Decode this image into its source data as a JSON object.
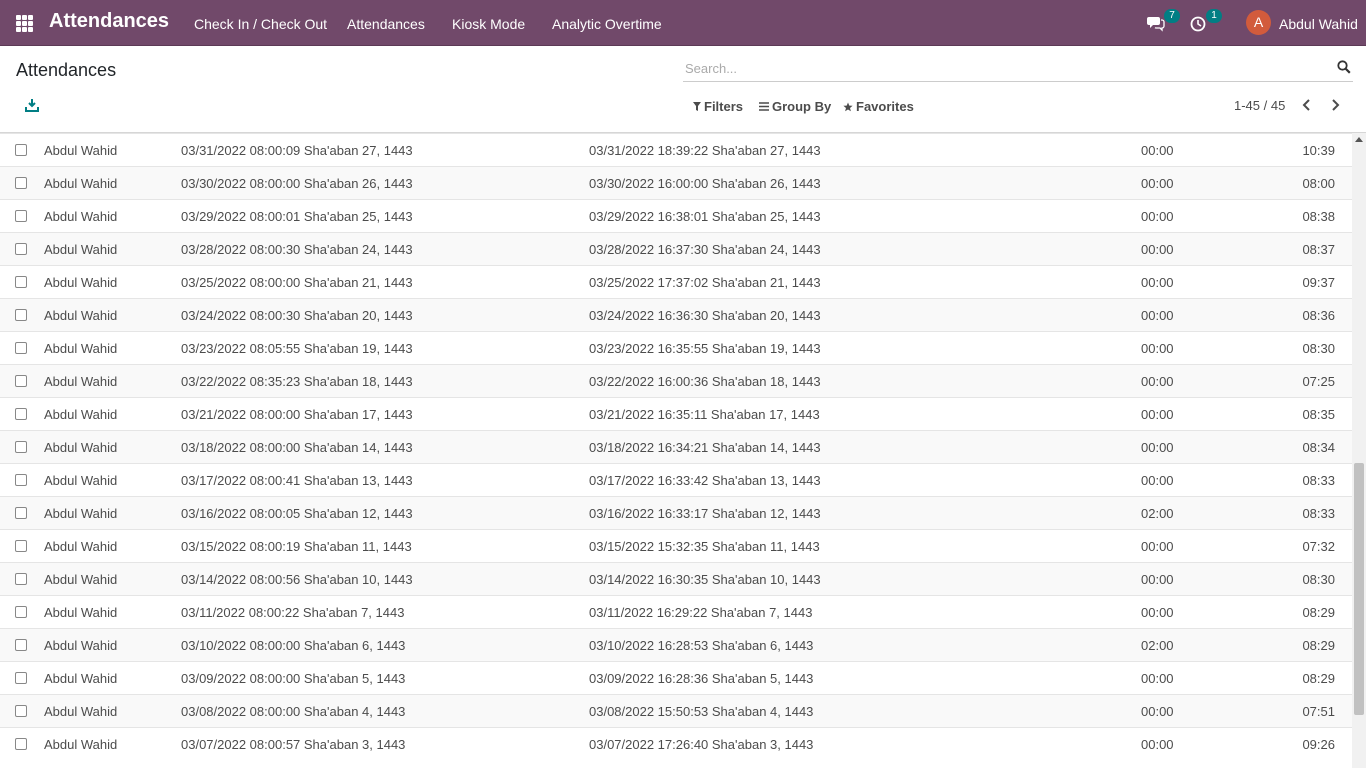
{
  "navbar": {
    "app_title": "Attendances",
    "menu": [
      "Check In / Check Out",
      "Attendances",
      "Kiosk Mode",
      "Analytic Overtime"
    ],
    "messages_count": "7",
    "activities_count": "1",
    "user_initial": "A",
    "user_name": "Abdul Wahid",
    "bg_color": "#71496a",
    "badge_color": "#017e84",
    "avatar_color": "#d25b3c"
  },
  "control_panel": {
    "title": "Attendances",
    "search_placeholder": "Search...",
    "filters_label": "Filters",
    "group_by_label": "Group By",
    "favorites_label": "Favorites",
    "pager_value": "1-45 / 45"
  },
  "rows": [
    {
      "employee": "Abdul Wahid",
      "check_in": "03/31/2022 08:00:09 Sha'aban 27, 1443",
      "check_out": "03/31/2022 18:39:22 Sha'aban 27, 1443",
      "overtime": "00:00",
      "worked": "10:39"
    },
    {
      "employee": "Abdul Wahid",
      "check_in": "03/30/2022 08:00:00 Sha'aban 26, 1443",
      "check_out": "03/30/2022 16:00:00 Sha'aban 26, 1443",
      "overtime": "00:00",
      "worked": "08:00"
    },
    {
      "employee": "Abdul Wahid",
      "check_in": "03/29/2022 08:00:01 Sha'aban 25, 1443",
      "check_out": "03/29/2022 16:38:01 Sha'aban 25, 1443",
      "overtime": "00:00",
      "worked": "08:38"
    },
    {
      "employee": "Abdul Wahid",
      "check_in": "03/28/2022 08:00:30 Sha'aban 24, 1443",
      "check_out": "03/28/2022 16:37:30 Sha'aban 24, 1443",
      "overtime": "00:00",
      "worked": "08:37"
    },
    {
      "employee": "Abdul Wahid",
      "check_in": "03/25/2022 08:00:00 Sha'aban 21, 1443",
      "check_out": "03/25/2022 17:37:02 Sha'aban 21, 1443",
      "overtime": "00:00",
      "worked": "09:37"
    },
    {
      "employee": "Abdul Wahid",
      "check_in": "03/24/2022 08:00:30 Sha'aban 20, 1443",
      "check_out": "03/24/2022 16:36:30 Sha'aban 20, 1443",
      "overtime": "00:00",
      "worked": "08:36"
    },
    {
      "employee": "Abdul Wahid",
      "check_in": "03/23/2022 08:05:55 Sha'aban 19, 1443",
      "check_out": "03/23/2022 16:35:55 Sha'aban 19, 1443",
      "overtime": "00:00",
      "worked": "08:30"
    },
    {
      "employee": "Abdul Wahid",
      "check_in": "03/22/2022 08:35:23 Sha'aban 18, 1443",
      "check_out": "03/22/2022 16:00:36 Sha'aban 18, 1443",
      "overtime": "00:00",
      "worked": "07:25"
    },
    {
      "employee": "Abdul Wahid",
      "check_in": "03/21/2022 08:00:00 Sha'aban 17, 1443",
      "check_out": "03/21/2022 16:35:11 Sha'aban 17, 1443",
      "overtime": "00:00",
      "worked": "08:35"
    },
    {
      "employee": "Abdul Wahid",
      "check_in": "03/18/2022 08:00:00 Sha'aban 14, 1443",
      "check_out": "03/18/2022 16:34:21 Sha'aban 14, 1443",
      "overtime": "00:00",
      "worked": "08:34"
    },
    {
      "employee": "Abdul Wahid",
      "check_in": "03/17/2022 08:00:41 Sha'aban 13, 1443",
      "check_out": "03/17/2022 16:33:42 Sha'aban 13, 1443",
      "overtime": "00:00",
      "worked": "08:33"
    },
    {
      "employee": "Abdul Wahid",
      "check_in": "03/16/2022 08:00:05 Sha'aban 12, 1443",
      "check_out": "03/16/2022 16:33:17 Sha'aban 12, 1443",
      "overtime": "02:00",
      "worked": "08:33"
    },
    {
      "employee": "Abdul Wahid",
      "check_in": "03/15/2022 08:00:19 Sha'aban 11, 1443",
      "check_out": "03/15/2022 15:32:35 Sha'aban 11, 1443",
      "overtime": "00:00",
      "worked": "07:32"
    },
    {
      "employee": "Abdul Wahid",
      "check_in": "03/14/2022 08:00:56 Sha'aban 10, 1443",
      "check_out": "03/14/2022 16:30:35 Sha'aban 10, 1443",
      "overtime": "00:00",
      "worked": "08:30"
    },
    {
      "employee": "Abdul Wahid",
      "check_in": "03/11/2022 08:00:22 Sha'aban 7, 1443",
      "check_out": "03/11/2022 16:29:22 Sha'aban 7, 1443",
      "overtime": "00:00",
      "worked": "08:29"
    },
    {
      "employee": "Abdul Wahid",
      "check_in": "03/10/2022 08:00:00 Sha'aban 6, 1443",
      "check_out": "03/10/2022 16:28:53 Sha'aban 6, 1443",
      "overtime": "02:00",
      "worked": "08:29"
    },
    {
      "employee": "Abdul Wahid",
      "check_in": "03/09/2022 08:00:00 Sha'aban 5, 1443",
      "check_out": "03/09/2022 16:28:36 Sha'aban 5, 1443",
      "overtime": "00:00",
      "worked": "08:29"
    },
    {
      "employee": "Abdul Wahid",
      "check_in": "03/08/2022 08:00:00 Sha'aban 4, 1443",
      "check_out": "03/08/2022 15:50:53 Sha'aban 4, 1443",
      "overtime": "00:00",
      "worked": "07:51"
    },
    {
      "employee": "Abdul Wahid",
      "check_in": "03/07/2022 08:00:57 Sha'aban 3, 1443",
      "check_out": "03/07/2022 17:26:40 Sha'aban 3, 1443",
      "overtime": "00:00",
      "worked": "09:26"
    }
  ]
}
